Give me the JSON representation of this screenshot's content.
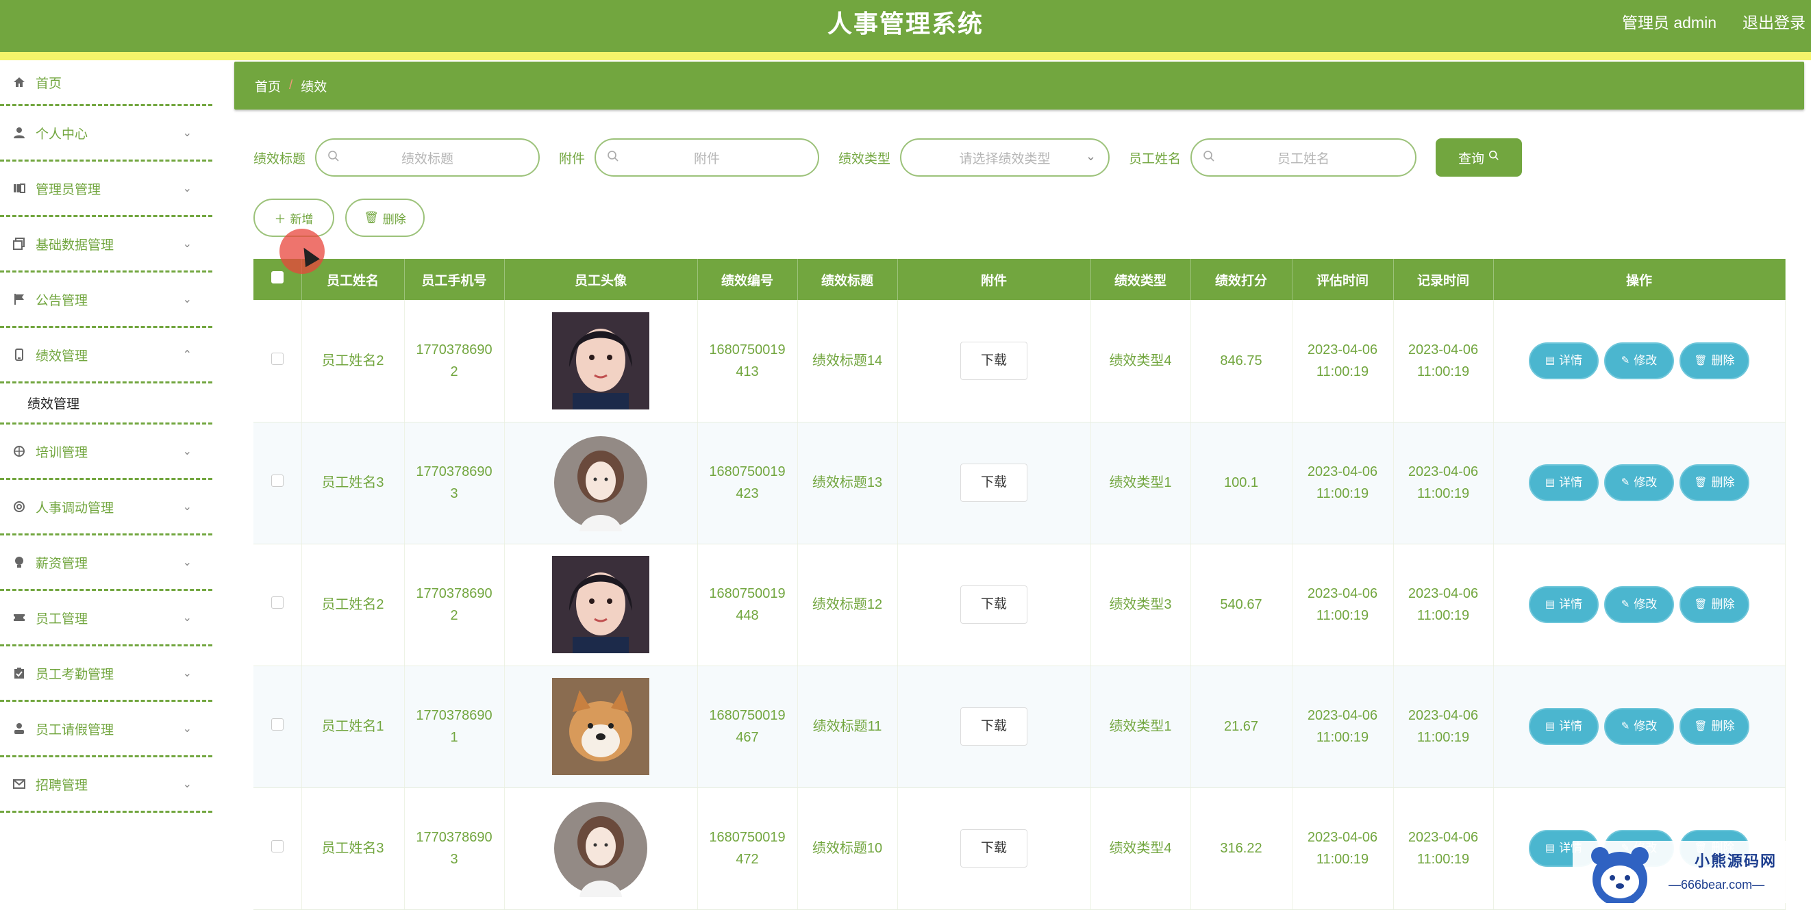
{
  "header": {
    "title": "人事管理系统",
    "user": "管理员 admin",
    "logout": "退出登录"
  },
  "sidebar": {
    "items": [
      {
        "label": "首页",
        "icon": "home-icon"
      },
      {
        "label": "个人中心",
        "icon": "person-icon"
      },
      {
        "label": "管理员管理",
        "icon": "admin-icon"
      },
      {
        "label": "基础数据管理",
        "icon": "copy-icon"
      },
      {
        "label": "公告管理",
        "icon": "flag-icon"
      },
      {
        "label": "绩效管理",
        "icon": "phone-icon",
        "expanded": true
      },
      {
        "label": "培训管理",
        "icon": "compass-icon"
      },
      {
        "label": "人事调动管理",
        "icon": "lifebuoy-icon"
      },
      {
        "label": "薪资管理",
        "icon": "bulb-icon"
      },
      {
        "label": "员工管理",
        "icon": "ticket-icon"
      },
      {
        "label": "员工考勤管理",
        "icon": "clipboard-icon"
      },
      {
        "label": "员工请假管理",
        "icon": "user-icon"
      },
      {
        "label": "招聘管理",
        "icon": "mail-icon"
      }
    ],
    "submenu": "绩效管理"
  },
  "breadcrumb": {
    "home": "首页",
    "separator": "/",
    "current": "绩效"
  },
  "search": {
    "title_label": "绩效标题",
    "title_placeholder": "绩效标题",
    "file_label": "附件",
    "file_placeholder": "附件",
    "type_label": "绩效类型",
    "type_placeholder": "请选择绩效类型",
    "name_label": "员工姓名",
    "name_placeholder": "员工姓名",
    "query_label": "查询"
  },
  "actions": {
    "add": "新增",
    "delete": "删除"
  },
  "table": {
    "headers": [
      "员工姓名",
      "员工手机号",
      "员工头像",
      "绩效编号",
      "绩效标题",
      "附件",
      "绩效类型",
      "绩效打分",
      "评估时间",
      "记录时间",
      "操作"
    ],
    "download": "下载",
    "btn_detail": "详情",
    "btn_edit": "修改",
    "btn_delete": "删除",
    "rows": [
      {
        "name": "员工姓名2",
        "phone1": "1770378690",
        "phone2": "2",
        "avatar": "girl-photo",
        "no1": "1680750019",
        "no2": "413",
        "title": "绩效标题14",
        "type": "绩效类型4",
        "score": "846.75",
        "eval1": "2023-04-06",
        "eval2": "11:00:19",
        "rec1": "2023-04-06",
        "rec2": "11:00:19"
      },
      {
        "name": "员工姓名3",
        "phone1": "1770378690",
        "phone2": "3",
        "avatar": "illustration",
        "no1": "1680750019",
        "no2": "423",
        "title": "绩效标题13",
        "type": "绩效类型1",
        "score": "100.1",
        "eval1": "2023-04-06",
        "eval2": "11:00:19",
        "rec1": "2023-04-06",
        "rec2": "11:00:19"
      },
      {
        "name": "员工姓名2",
        "phone1": "1770378690",
        "phone2": "2",
        "avatar": "girl-photo",
        "no1": "1680750019",
        "no2": "448",
        "title": "绩效标题12",
        "type": "绩效类型3",
        "score": "540.67",
        "eval1": "2023-04-06",
        "eval2": "11:00:19",
        "rec1": "2023-04-06",
        "rec2": "11:00:19"
      },
      {
        "name": "员工姓名1",
        "phone1": "1770378690",
        "phone2": "1",
        "avatar": "dog-photo",
        "no1": "1680750019",
        "no2": "467",
        "title": "绩效标题11",
        "type": "绩效类型1",
        "score": "21.67",
        "eval1": "2023-04-06",
        "eval2": "11:00:19",
        "rec1": "2023-04-06",
        "rec2": "11:00:19"
      },
      {
        "name": "员工姓名3",
        "phone1": "1770378690",
        "phone2": "3",
        "avatar": "illustration",
        "no1": "1680750019",
        "no2": "472",
        "title": "绩效标题10",
        "type": "绩效类型4",
        "score": "316.22",
        "eval1": "2023-04-06",
        "eval2": "11:00:19",
        "rec1": "2023-04-06",
        "rec2": "11:00:19"
      }
    ]
  },
  "watermark": {
    "line1": "小熊源码网",
    "line2": "—666bear.com—"
  },
  "colors": {
    "primary": "#72a63f",
    "stripe": "#f4f46a",
    "action": "#4bb6cf"
  }
}
